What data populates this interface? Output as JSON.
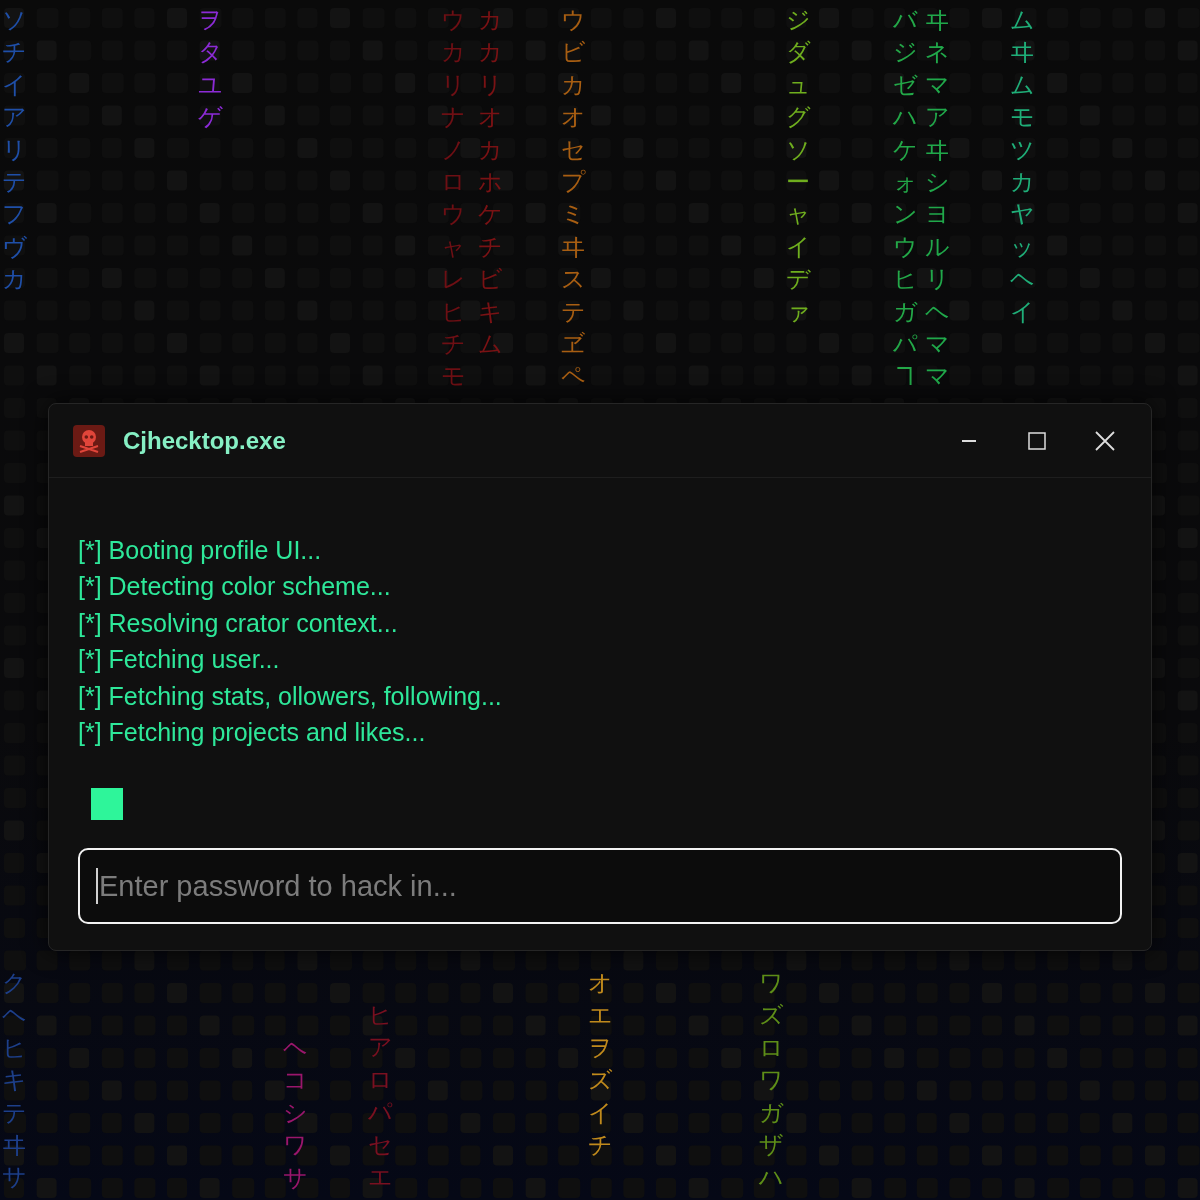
{
  "background": {
    "top_columns": [
      {
        "text": "ソチイアリテフヴカ",
        "color": "#1f4fa8"
      },
      {
        "text": "ヲタユゲ",
        "color": "#8c2bd6"
      },
      {
        "text": "ウカリナノロウャレヒチモ",
        "color": "#6e0f14"
      },
      {
        "text": "カカリオカホケチビキム",
        "color": "#7a1214"
      },
      {
        "text": "ウビカオセプミヰステヹペ",
        "color": "#a85e12"
      },
      {
        "text": "ジダュグソーャイデァ",
        "color": "#6fae1e"
      },
      {
        "text": "バジゼハケォンウヒガパヿ",
        "color": "#23a848"
      },
      {
        "text": "ヰネマアヰシヨルリヘママ",
        "color": "#20a84a"
      },
      {
        "text": "ムヰムモツカヤッヘイ",
        "color": "#1fae78"
      }
    ],
    "bottom_columns": [
      {
        "text": "クヘヒキテヰサ",
        "color": "#1d3f8a"
      },
      {
        "text": "ヘコシワサ",
        "color": "#9a166c"
      },
      {
        "text": "ヒアロパセエ",
        "color": "#7a1020"
      },
      {
        "text": "オエヲズイチ",
        "color": "#c08a1c"
      },
      {
        "text": "ワズロワガザハ",
        "color": "#5e8e18"
      }
    ]
  },
  "window": {
    "title": "Cjhecktop.exe",
    "log": [
      "[*] Booting profile UI...",
      "[*] Detecting color scheme...",
      "[*] Resolving crator context...",
      "[*] Fetching user...",
      "[*] Fetching stats, ollowers, following...",
      "[*] Fetching projects and likes..."
    ],
    "password": {
      "placeholder": "Enter password to hack in..."
    }
  }
}
